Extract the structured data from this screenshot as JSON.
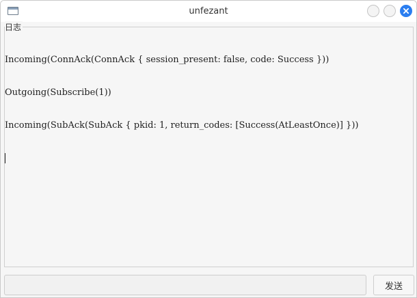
{
  "window": {
    "title": "unfezant",
    "icon": "app-window-icon",
    "controls": [
      "minimize-icon",
      "maximize-icon",
      "close-icon"
    ],
    "accent_color": "#2b7ef0"
  },
  "log": {
    "label": "日志",
    "lines": [
      "Incoming(ConnAck(ConnAck { session_present: false, code: Success }))",
      "Outgoing(Subscribe(1))",
      "Incoming(SubAck(SubAck { pkid: 1, return_codes: [Success(AtLeastOnce)] }))"
    ]
  },
  "composer": {
    "input_value": "",
    "input_placeholder": "",
    "send_label": "发送"
  }
}
